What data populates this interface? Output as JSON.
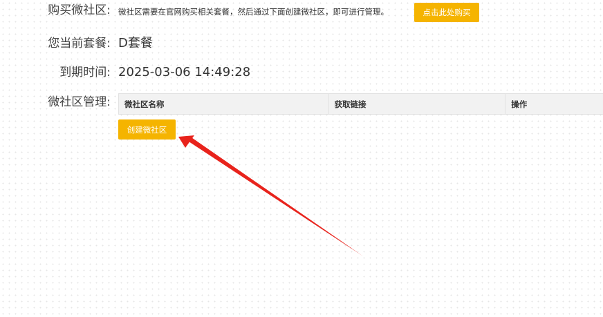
{
  "purchase": {
    "label": "购买微社区:",
    "hint": "微社区需要在官网购买相关套餐，然后通过下面创建微社区，即可进行管理。",
    "buy_button": "点击此处购买"
  },
  "plan": {
    "label": "您当前套餐:",
    "value": "D套餐"
  },
  "expiry": {
    "label": "到期时间:",
    "value": "2025-03-06 14:49:28"
  },
  "management": {
    "label": "微社区管理:",
    "columns": [
      "微社区名称",
      "获取链接",
      "操作"
    ],
    "create_button": "创建微社区"
  },
  "colors": {
    "accent": "#f5b400",
    "annotation_arrow": "#e8231c"
  },
  "icons": {
    "annotation": "red-arrow-icon"
  }
}
